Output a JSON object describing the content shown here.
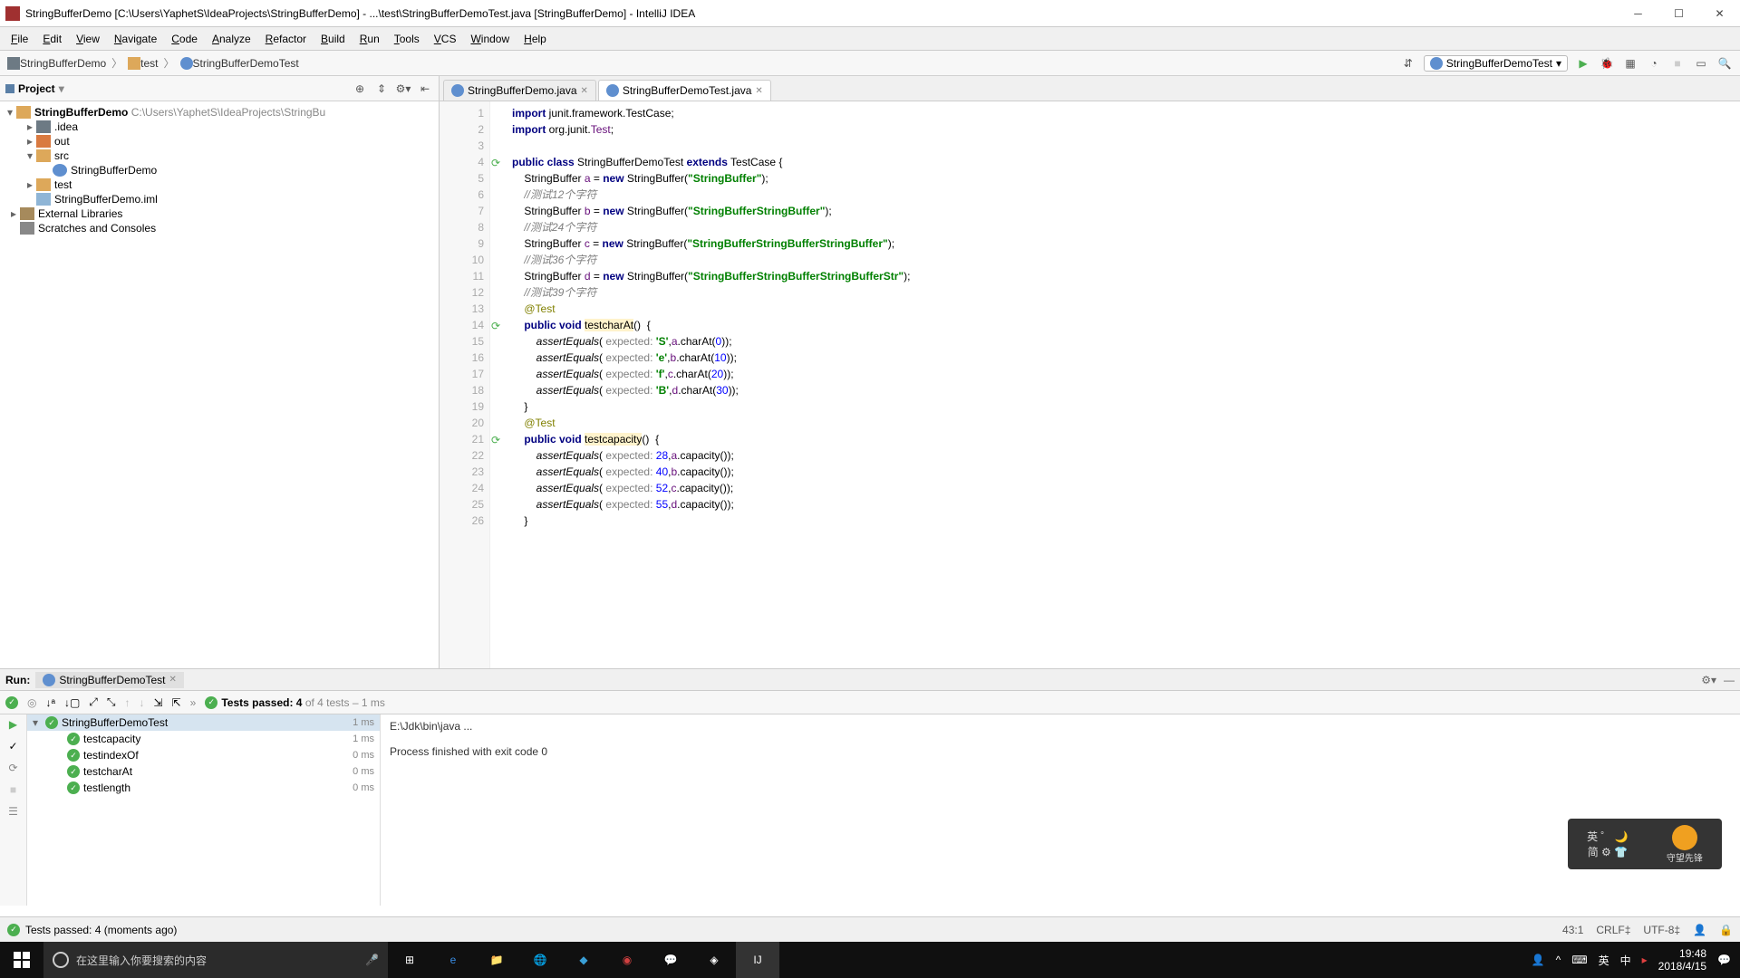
{
  "window": {
    "title": "StringBufferDemo [C:\\Users\\YaphetS\\IdeaProjects\\StringBufferDemo] - ...\\test\\StringBufferDemoTest.java [StringBufferDemo] - IntelliJ IDEA"
  },
  "menubar": [
    "File",
    "Edit",
    "View",
    "Navigate",
    "Code",
    "Analyze",
    "Refactor",
    "Build",
    "Run",
    "Tools",
    "VCS",
    "Window",
    "Help"
  ],
  "breadcrumbs": [
    "StringBufferDemo",
    "test",
    "StringBufferDemoTest"
  ],
  "run_config": "StringBufferDemoTest",
  "project_panel": {
    "title": "Project",
    "root": {
      "label": "StringBufferDemo",
      "path": "C:\\Users\\YaphetS\\IdeaProjects\\StringBu"
    },
    "nodes": [
      {
        "indent": 1,
        "arrow": ">",
        "icon": "darkfolder",
        "label": ".idea"
      },
      {
        "indent": 1,
        "arrow": ">",
        "icon": "out",
        "label": "out"
      },
      {
        "indent": 1,
        "arrow": "v",
        "icon": "folder",
        "label": "src"
      },
      {
        "indent": 2,
        "arrow": "",
        "icon": "javaC",
        "label": "StringBufferDemo"
      },
      {
        "indent": 1,
        "arrow": ">",
        "icon": "folder",
        "label": "test"
      },
      {
        "indent": 1,
        "arrow": "",
        "icon": "file",
        "label": "StringBufferDemo.iml"
      },
      {
        "indent": 0,
        "arrow": ">",
        "icon": "lib",
        "label": "External Libraries"
      },
      {
        "indent": 0,
        "arrow": "",
        "icon": "scratch",
        "label": "Scratches and Consoles"
      }
    ]
  },
  "tabs": [
    {
      "label": "StringBufferDemo.java",
      "active": false
    },
    {
      "label": "StringBufferDemoTest.java",
      "active": true
    }
  ],
  "code_lines": [
    {
      "n": 1,
      "html": "<span class='kw'>import</span> junit.framework.TestCase;"
    },
    {
      "n": 2,
      "html": "<span class='kw'>import</span> org.junit.<span class='field'>Test</span>;"
    },
    {
      "n": 3,
      "html": ""
    },
    {
      "n": 4,
      "html": "<span class='kw'>public class</span> StringBufferDemoTest <span class='kw'>extends</span> TestCase {",
      "mark": "run"
    },
    {
      "n": 5,
      "html": "    StringBuffer <span class='field'>a</span> = <span class='kw'>new</span> StringBuffer(<span class='str'>\"StringBuffer\"</span>);"
    },
    {
      "n": 6,
      "html": "    <span class='cmt'>//测试12个字符</span>"
    },
    {
      "n": 7,
      "html": "    StringBuffer <span class='field'>b</span> = <span class='kw'>new</span> StringBuffer(<span class='str'>\"StringBufferStringBuffer\"</span>);"
    },
    {
      "n": 8,
      "html": "    <span class='cmt'>//测试24个字符</span>"
    },
    {
      "n": 9,
      "html": "    StringBuffer <span class='field'>c</span> = <span class='kw'>new</span> StringBuffer(<span class='str'>\"StringBufferStringBufferStringBuffer\"</span>);"
    },
    {
      "n": 10,
      "html": "    <span class='cmt'>//测试36个字符</span>"
    },
    {
      "n": 11,
      "html": "    StringBuffer <span class='field'>d</span> = <span class='kw'>new</span> StringBuffer(<span class='str'>\"StringBufferStringBufferStringBufferStr\"</span>);"
    },
    {
      "n": 12,
      "html": "    <span class='cmt'>//测试39个字符</span>"
    },
    {
      "n": 13,
      "html": "    <span class='ann'>@Test</span>"
    },
    {
      "n": 14,
      "html": "    <span class='kw'>public void</span> <span class='mname'>testcharAt</span>()  {",
      "mark": "run"
    },
    {
      "n": 15,
      "html": "        <span style='font-style:italic'>assertEquals</span>( <span class='param'>expected:</span> <span class='str'>'S'</span>,<span class='field'>a</span>.charAt(<span class='num'>0</span>));"
    },
    {
      "n": 16,
      "html": "        <span style='font-style:italic'>assertEquals</span>( <span class='param'>expected:</span> <span class='str'>'e'</span>,<span class='field'>b</span>.charAt(<span class='num'>10</span>));"
    },
    {
      "n": 17,
      "html": "        <span style='font-style:italic'>assertEquals</span>( <span class='param'>expected:</span> <span class='str'>'f'</span>,<span class='field'>c</span>.charAt(<span class='num'>20</span>));"
    },
    {
      "n": 18,
      "html": "        <span style='font-style:italic'>assertEquals</span>( <span class='param'>expected:</span> <span class='str'>'B'</span>,<span class='field'>d</span>.charAt(<span class='num'>30</span>));"
    },
    {
      "n": 19,
      "html": "    }"
    },
    {
      "n": 20,
      "html": "    <span class='ann'>@Test</span>"
    },
    {
      "n": 21,
      "html": "    <span class='kw'>public void</span> <span class='mname'>testcapacity</span>()  {",
      "mark": "run"
    },
    {
      "n": 22,
      "html": "        <span style='font-style:italic'>assertEquals</span>( <span class='param'>expected:</span> <span class='num'>28</span>,<span class='field'>a</span>.capacity());"
    },
    {
      "n": 23,
      "html": "        <span style='font-style:italic'>assertEquals</span>( <span class='param'>expected:</span> <span class='num'>40</span>,<span class='field'>b</span>.capacity());"
    },
    {
      "n": 24,
      "html": "        <span style='font-style:italic'>assertEquals</span>( <span class='param'>expected:</span> <span class='num'>52</span>,<span class='field'>c</span>.capacity());"
    },
    {
      "n": 25,
      "html": "        <span style='font-style:italic'>assertEquals</span>( <span class='param'>expected:</span> <span class='num'>55</span>,<span class='field'>d</span>.capacity());"
    },
    {
      "n": 26,
      "html": "    }"
    }
  ],
  "run_panel": {
    "title": "Run:",
    "tab": "StringBufferDemoTest",
    "status_text": "Tests passed: 4",
    "status_suffix": " of 4 tests – 1 ms",
    "tests": [
      {
        "label": "StringBufferDemoTest",
        "time": "1 ms",
        "sel": true,
        "indent": 0,
        "arrow": "v"
      },
      {
        "label": "testcapacity",
        "time": "1 ms",
        "indent": 1
      },
      {
        "label": "testindexOf",
        "time": "0 ms",
        "indent": 1
      },
      {
        "label": "testcharAt",
        "time": "0 ms",
        "indent": 1
      },
      {
        "label": "testlength",
        "time": "0 ms",
        "indent": 1
      }
    ],
    "console": [
      "E:\\Jdk\\bin\\java ...",
      "",
      "Process finished with exit code 0"
    ]
  },
  "statusbar": {
    "msg": "Tests passed: 4 (moments ago)",
    "pos": "43:1",
    "lf": "CRLF",
    "enc": "UTF-8"
  },
  "taskbar": {
    "search_placeholder": "在这里输入你要搜索的内容",
    "time": "19:48",
    "date": "2018/4/15",
    "lang": "英",
    "zh": "中"
  }
}
